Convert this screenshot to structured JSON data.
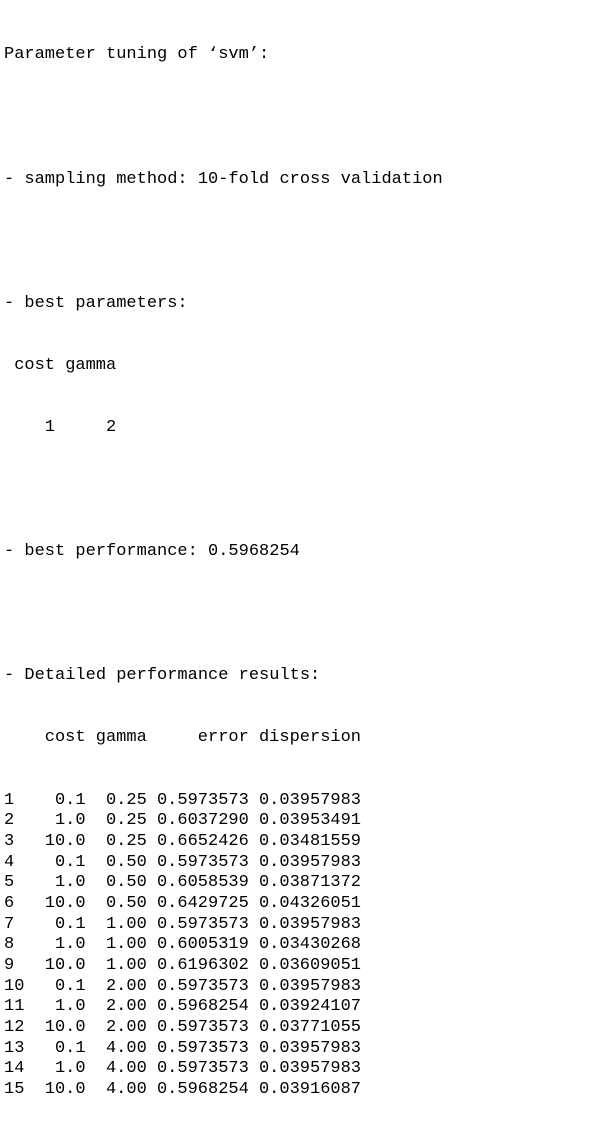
{
  "header": {
    "title": "Parameter tuning of ‘svm’:"
  },
  "sampling": {
    "text": "- sampling method: 10-fold cross validation"
  },
  "best_parameters": {
    "heading": "- best parameters:",
    "col_cost": "cost",
    "col_gamma": "gamma",
    "val_cost": "1",
    "val_gamma": "2"
  },
  "best_performance": {
    "text": "- best performance: 0.5968254"
  },
  "detailed": {
    "heading": "- Detailed performance results:",
    "columns": {
      "cost": "cost",
      "gamma": "gamma",
      "error": "error",
      "dispersion": "dispersion"
    },
    "rows": [
      {
        "idx": "1",
        "cost": "0.1",
        "gamma": "0.25",
        "error": "0.5973573",
        "dispersion": "0.03957983"
      },
      {
        "idx": "2",
        "cost": "1.0",
        "gamma": "0.25",
        "error": "0.6037290",
        "dispersion": "0.03953491"
      },
      {
        "idx": "3",
        "cost": "10.0",
        "gamma": "0.25",
        "error": "0.6652426",
        "dispersion": "0.03481559"
      },
      {
        "idx": "4",
        "cost": "0.1",
        "gamma": "0.50",
        "error": "0.5973573",
        "dispersion": "0.03957983"
      },
      {
        "idx": "5",
        "cost": "1.0",
        "gamma": "0.50",
        "error": "0.6058539",
        "dispersion": "0.03871372"
      },
      {
        "idx": "6",
        "cost": "10.0",
        "gamma": "0.50",
        "error": "0.6429725",
        "dispersion": "0.04326051"
      },
      {
        "idx": "7",
        "cost": "0.1",
        "gamma": "1.00",
        "error": "0.5973573",
        "dispersion": "0.03957983"
      },
      {
        "idx": "8",
        "cost": "1.0",
        "gamma": "1.00",
        "error": "0.6005319",
        "dispersion": "0.03430268"
      },
      {
        "idx": "9",
        "cost": "10.0",
        "gamma": "1.00",
        "error": "0.6196302",
        "dispersion": "0.03609051"
      },
      {
        "idx": "10",
        "cost": "0.1",
        "gamma": "2.00",
        "error": "0.5973573",
        "dispersion": "0.03957983"
      },
      {
        "idx": "11",
        "cost": "1.0",
        "gamma": "2.00",
        "error": "0.5968254",
        "dispersion": "0.03924107"
      },
      {
        "idx": "12",
        "cost": "10.0",
        "gamma": "2.00",
        "error": "0.5973573",
        "dispersion": "0.03771055"
      },
      {
        "idx": "13",
        "cost": "0.1",
        "gamma": "4.00",
        "error": "0.5973573",
        "dispersion": "0.03957983"
      },
      {
        "idx": "14",
        "cost": "1.0",
        "gamma": "4.00",
        "error": "0.5973573",
        "dispersion": "0.03957983"
      },
      {
        "idx": "15",
        "cost": "10.0",
        "gamma": "4.00",
        "error": "0.5968254",
        "dispersion": "0.03916087"
      }
    ]
  }
}
